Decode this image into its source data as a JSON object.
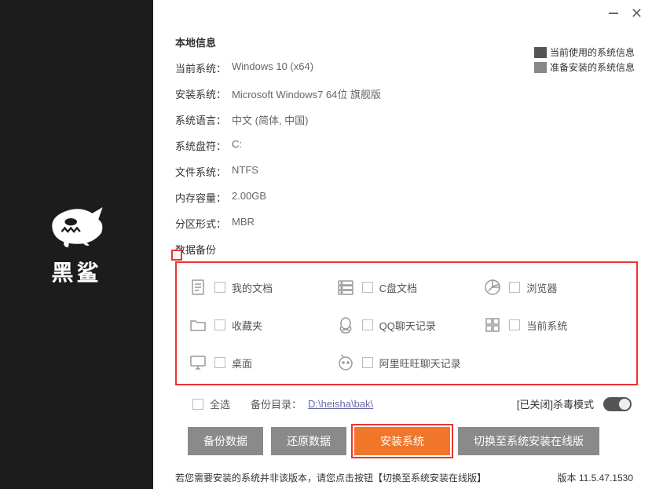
{
  "brand": "黑鲨",
  "window": {
    "minimize": "—",
    "close": "✕"
  },
  "local_info_title": "本地信息",
  "legend": {
    "current": "当前使用的系统信息",
    "target": "准备安装的系统信息"
  },
  "info": {
    "current_os_label": "当前系统：",
    "current_os_value": "Windows 10 (x64)",
    "install_os_label": "安装系统：",
    "install_os_value": "Microsoft Windows7 64位 旗舰版",
    "lang_label": "系统语言：",
    "lang_value": "中文 (简体, 中国)",
    "drive_label": "系统盘符：",
    "drive_value": "C:",
    "fs_label": "文件系统：",
    "fs_value": "NTFS",
    "mem_label": "内存容量：",
    "mem_value": "2.00GB",
    "part_label": "分区形式：",
    "part_value": "MBR"
  },
  "backup_section_title": "数据备份",
  "backup": {
    "my_docs": "我的文档",
    "c_docs": "C盘文档",
    "browser": "浏览器",
    "favorites": "收藏夹",
    "qq_chat": "QQ聊天记录",
    "current_sys": "当前系统",
    "desktop": "桌面",
    "aliwangwang": "阿里旺旺聊天记录"
  },
  "select_all": "全选",
  "backup_dir_label": "备份目录：",
  "backup_dir_path": "D:\\heisha\\bak\\",
  "antivirus_label": "[已关闭]杀毒模式",
  "buttons": {
    "backup": "备份数据",
    "restore": "还原数据",
    "install": "安装系统",
    "switch_online": "切换至系统安装在线版"
  },
  "footer_note": "若您需要安装的系统并非该版本，请您点击按钮【切换至系统安装在线版】",
  "version_label": "版本 11.5.47.1530"
}
